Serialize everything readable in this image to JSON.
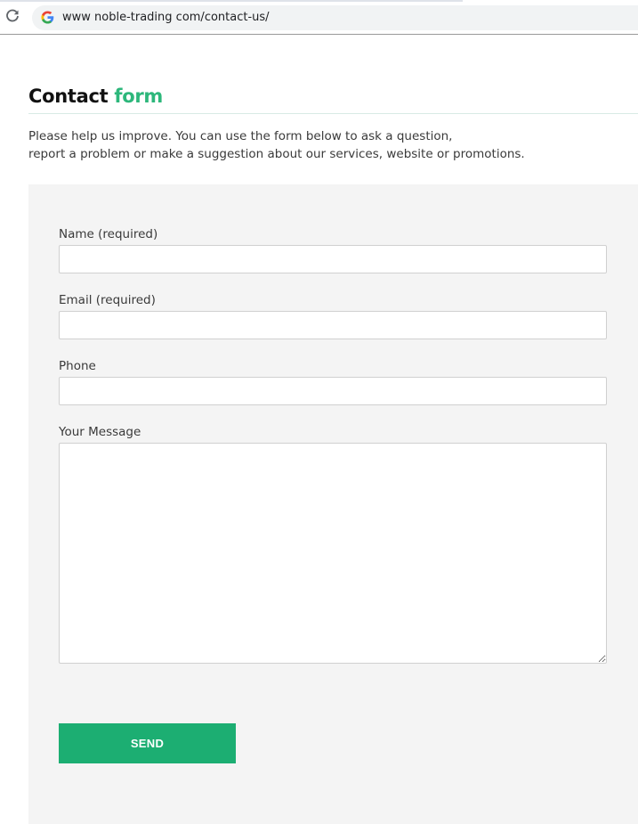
{
  "browser": {
    "url": "www noble-trading com/contact-us/",
    "reload_icon": "reload-icon",
    "site_icon": "google-icon"
  },
  "page": {
    "title_main": "Contact ",
    "title_accent": "form",
    "intro_line1": "Please help us improve. You can use the form below to ask a question,",
    "intro_line2": "report a problem or make a suggestion about our services, website or promotions."
  },
  "form": {
    "name_label": "Name (required)",
    "name_value": "",
    "email_label": "Email (required)",
    "email_value": "",
    "phone_label": "Phone",
    "phone_value": "",
    "message_label": "Your Message",
    "message_value": "",
    "send_label": "SEND"
  },
  "colors": {
    "accent": "#2db77b",
    "button": "#1cae72",
    "panel": "#f4f4f4"
  }
}
